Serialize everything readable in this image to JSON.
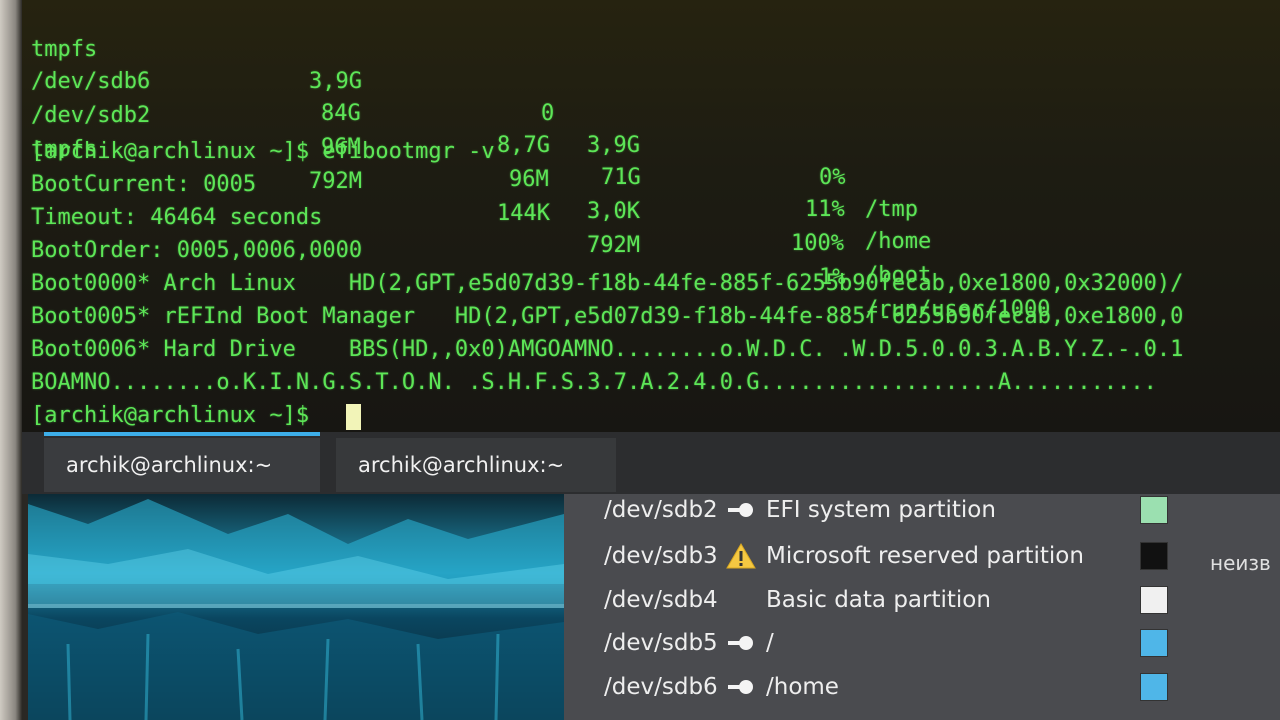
{
  "terminal": {
    "df_rows": [
      {
        "fs": "tmpfs",
        "size": "3,9G",
        "used": "0",
        "avail": "3,9G",
        "use": "0%",
        "mount": "/tmp"
      },
      {
        "fs": "/dev/sdb6",
        "size": "84G",
        "used": "8,7G",
        "avail": "71G",
        "use": "11%",
        "mount": "/home"
      },
      {
        "fs": "/dev/sdb2",
        "size": "96M",
        "used": "96M",
        "avail": "3,0K",
        "use": "100%",
        "mount": "/boot"
      },
      {
        "fs": "tmpfs",
        "size": "792M",
        "used": "144K",
        "avail": "792M",
        "use": "1%",
        "mount": "/run/user/1000"
      }
    ],
    "lines": [
      "[archik@archlinux ~]$ efibootmgr -v",
      "BootCurrent: 0005",
      "Timeout: 46464 seconds",
      "BootOrder: 0005,0006,0000",
      "Boot0000* Arch Linux    HD(2,GPT,e5d07d39-f18b-44fe-885f-6255b90fecab,0xe1800,0x32000)/",
      "Boot0005* rEFInd Boot Manager   HD(2,GPT,e5d07d39-f18b-44fe-885f-6255b90fecab,0xe1800,0",
      "Boot0006* Hard Drive    BBS(HD,,0x0)AMGOAMNO........o.W.D.C. .W.D.5.0.0.3.A.B.Y.Z.-.0.1",
      "BOAMNO........o.K.I.N.G.S.T.O.N. .S.H.F.S.3.7.A.2.4.0.G..................A..........."
    ],
    "prompt": "[archik@archlinux ~]$ "
  },
  "tabs": [
    {
      "label": "archik@archlinux:~",
      "active": true
    },
    {
      "label": "archik@archlinux:~",
      "active": false
    }
  ],
  "partitions": [
    {
      "device": "/dev/sdb2",
      "mark": "key-icon",
      "label": "EFI system partition",
      "color": "#9be0b0"
    },
    {
      "device": "/dev/sdb3",
      "mark": "warning-icon",
      "label": "Microsoft reserved partition",
      "color": "#111111"
    },
    {
      "device": "/dev/sdb4",
      "mark": "",
      "label": "Basic data partition",
      "color": "#f0f0f0"
    },
    {
      "device": "/dev/sdb5",
      "mark": "key-icon",
      "label": "/",
      "color": "#4fb6e8"
    },
    {
      "device": "/dev/sdb6",
      "mark": "key-icon",
      "label": "/home",
      "color": "#4fb6e8"
    }
  ],
  "side_text": "неизв",
  "colors": {
    "terminal_fg": "#5de657",
    "accent": "#3daee9"
  }
}
